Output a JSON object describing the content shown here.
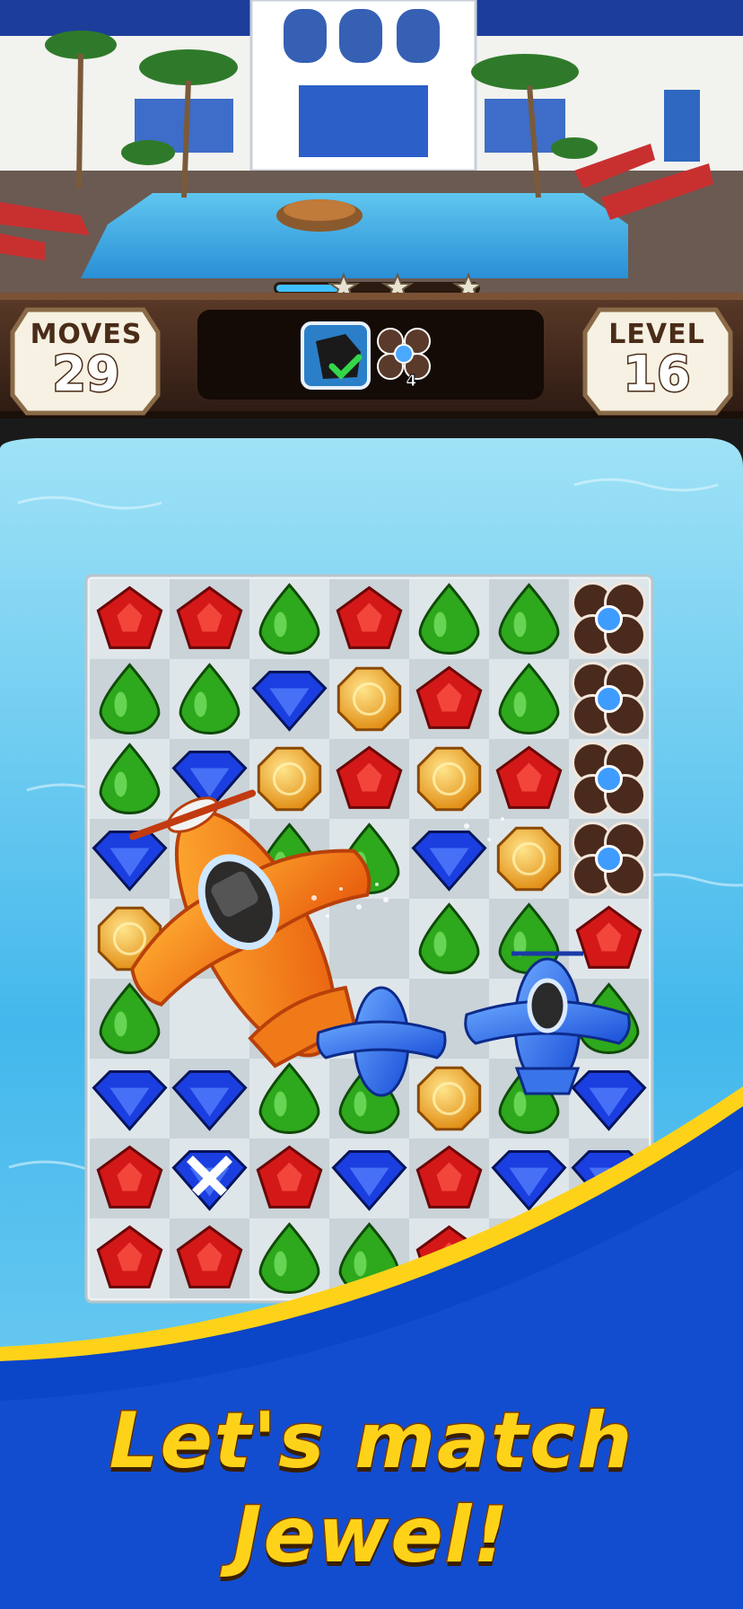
{
  "hud": {
    "moves_label": "MOVES",
    "moves_value": "29",
    "level_label": "LEVEL",
    "level_value": "16",
    "progress_stars": 3,
    "goals": [
      {
        "icon": "rock-tile-icon",
        "status": "complete"
      },
      {
        "icon": "flower-blocker-icon",
        "remaining": "4"
      }
    ]
  },
  "board": {
    "rows": [
      [
        "red",
        "red",
        "green",
        "red",
        "green",
        "green",
        "blocker"
      ],
      [
        "green",
        "green",
        "blue",
        "orange",
        "red",
        "green",
        "blocker"
      ],
      [
        "green",
        "blue",
        "orange",
        "red",
        "orange",
        "red",
        "blocker"
      ],
      [
        "blue",
        "",
        "green",
        "green",
        "blue",
        "orange",
        "blocker"
      ],
      [
        "orange",
        "",
        "",
        "",
        "green",
        "green",
        "red"
      ],
      [
        "green",
        "",
        "",
        "",
        "",
        "",
        "green"
      ],
      [
        "blue",
        "blue",
        "green",
        "green",
        "orange",
        "green",
        "blue"
      ],
      [
        "red",
        "blue-x",
        "red",
        "blue",
        "red",
        "blue",
        "blue"
      ],
      [
        "red",
        "red",
        "green",
        "green",
        "red",
        "",
        ""
      ]
    ],
    "colors": {
      "red": "#d41818",
      "green": "#2ea81c",
      "blue": "#1a3ee0",
      "orange": "#f2a21a",
      "blocker": "#4a2a1c"
    }
  },
  "tagline": {
    "line1": "Let's match",
    "line2": "Jewel!"
  },
  "accent_colors": {
    "banner_blue": "#0b45c8",
    "banner_stripe": "#ffd21a",
    "hud_wood": "#3d2418"
  }
}
